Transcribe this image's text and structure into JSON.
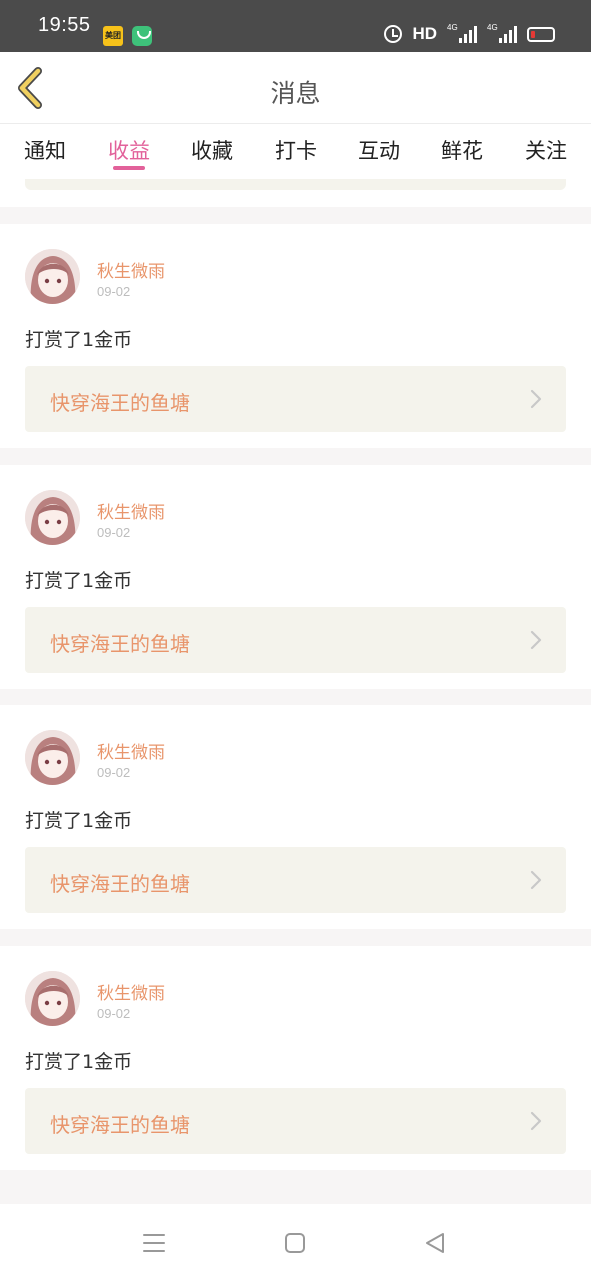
{
  "status_bar": {
    "time": "19:55",
    "app1_label": "美团",
    "hd": "HD",
    "net1": "4G",
    "net2": "4G"
  },
  "header": {
    "title": "消息",
    "back_icon": "chevron-left-icon"
  },
  "tabs": [
    {
      "label": "通知",
      "active": false
    },
    {
      "label": "收益",
      "active": true
    },
    {
      "label": "收藏",
      "active": false
    },
    {
      "label": "打卡",
      "active": false
    },
    {
      "label": "互动",
      "active": false
    },
    {
      "label": "鲜花",
      "active": false
    },
    {
      "label": "关注",
      "active": false
    }
  ],
  "items": [
    {
      "user": "秋生微雨",
      "date": "09-02",
      "action": "打赏了1金币",
      "book": "快穿海王的鱼塘"
    },
    {
      "user": "秋生微雨",
      "date": "09-02",
      "action": "打赏了1金币",
      "book": "快穿海王的鱼塘"
    },
    {
      "user": "秋生微雨",
      "date": "09-02",
      "action": "打赏了1金币",
      "book": "快穿海王的鱼塘"
    },
    {
      "user": "秋生微雨",
      "date": "09-02",
      "action": "打赏了1金币",
      "book": "快穿海王的鱼塘"
    }
  ],
  "colors": {
    "accent": "#e2619a",
    "username": "#e8956b",
    "book_bg": "#f4f3ec",
    "back_icon": "#f0d060"
  },
  "navbar": [
    "menu-icon",
    "home-square-icon",
    "back-triangle-icon"
  ]
}
